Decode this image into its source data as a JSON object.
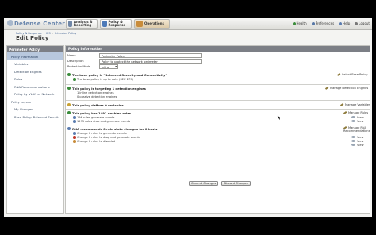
{
  "header": {
    "brand": "Defense Center",
    "tabs": [
      {
        "label": "Analysis & Reporting",
        "icon": "analysis-icon",
        "color": "#6f86a6"
      },
      {
        "label": "Policy & Response",
        "icon": "policy-icon",
        "color": "#4d7ab8"
      },
      {
        "label": "Operations",
        "icon": "operations-icon",
        "color": "#c98c3a"
      }
    ],
    "links": [
      {
        "label": "Health",
        "icon": "health-icon",
        "color": "#3a8c3a"
      },
      {
        "label": "Preferences",
        "icon": "preferences-icon",
        "color": "#5576a6"
      },
      {
        "label": "Help",
        "icon": "help-icon",
        "color": "#5b7db0"
      },
      {
        "label": "Logout",
        "icon": "logout-icon",
        "color": "#777777"
      }
    ]
  },
  "breadcrumb": [
    "Policy & Response",
    "IPS",
    "Intrusion Policy"
  ],
  "page_title": "Edit Policy",
  "sidebar": {
    "title": "Perimeter Policy",
    "items": [
      {
        "label": "Policy Information",
        "selected": true
      },
      {
        "label": "Variables"
      },
      {
        "label": "Detection Engines"
      },
      {
        "label": "Rules"
      },
      {
        "label": "RNA Recommendations"
      },
      {
        "label": "Policy by VLAN or Network"
      },
      {
        "label": "Policy Layers"
      },
      {
        "label": "My Changes"
      },
      {
        "label": "Base Policy: Balanced Securit"
      }
    ]
  },
  "policy_info": {
    "section_title": "Policy Information",
    "name_label": "Name",
    "name_value": "Perimeter Policy",
    "description_label": "Description",
    "description_value": "Policy to protect the network perimeter",
    "mode_label": "Protection Mode",
    "mode_value": "Inline"
  },
  "blocks": {
    "base": {
      "title": "The base policy is \"Balanced Security and Connectivity\"",
      "line1": "The base policy is up to date (SEU 279)",
      "action": "Select Base Policy"
    },
    "engines": {
      "title": "This policy is targeting 1 detection engines",
      "line1": "1 inline detection engines",
      "line2": "0 passive detection engines",
      "action": "Manage Detection Engines"
    },
    "variables": {
      "title": "This policy defines 0 variables",
      "action": "Manage Variables"
    },
    "rules": {
      "title": "This policy has 1491 enabled rules",
      "line1": "196 rules generate events",
      "line2": "1295 rules drop and generate events",
      "action": "Manage Rules",
      "view": "View"
    },
    "rna": {
      "title": "RNA recommends 0 rule state changes for 0 hosts",
      "line1": "Change 0 rules to generate events",
      "line2": "Change 0 rules to drop and generate events",
      "line3": "Change 0 rules to disabled",
      "action": "Manage RNA Recommendations",
      "view": "View"
    }
  },
  "buttons": {
    "commit": "Commit Changes",
    "discard": "Discard Changes"
  },
  "colors": {
    "section_header": "#7c7f86",
    "link": "#3d5f91",
    "selected_row": "#b8c8de",
    "ok": "#3a8c3a",
    "warn": "#c9a232",
    "error": "#c0392b"
  }
}
